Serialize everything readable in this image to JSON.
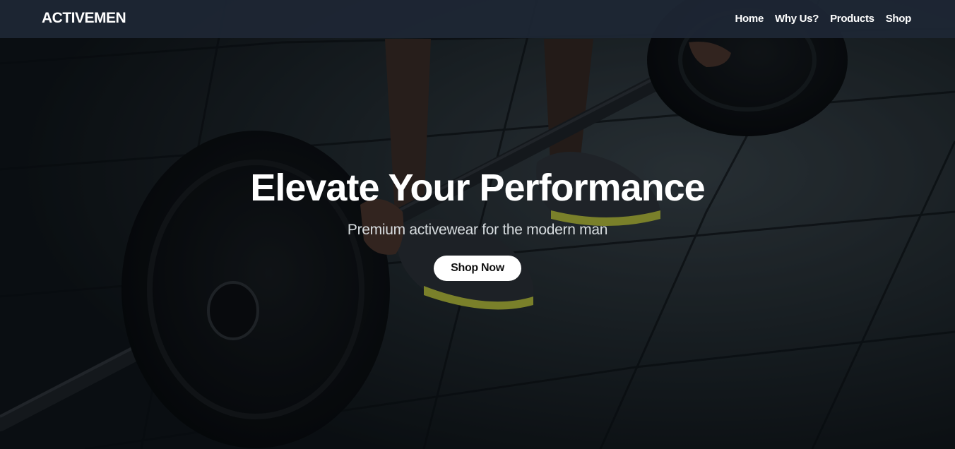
{
  "nav": {
    "brand": "ACTIVEMEN",
    "links": [
      "Home",
      "Why Us?",
      "Products",
      "Shop"
    ]
  },
  "hero": {
    "title": "Elevate Your Performance",
    "subtitle": "Premium activewear for the modern man",
    "cta_label": "Shop Now",
    "background_image": "barbell-deadlift-gym-floor"
  },
  "colors": {
    "navbar_bg": "#1e2735",
    "text": "#ffffff",
    "button_bg": "#ffffff",
    "button_text": "#111111"
  }
}
